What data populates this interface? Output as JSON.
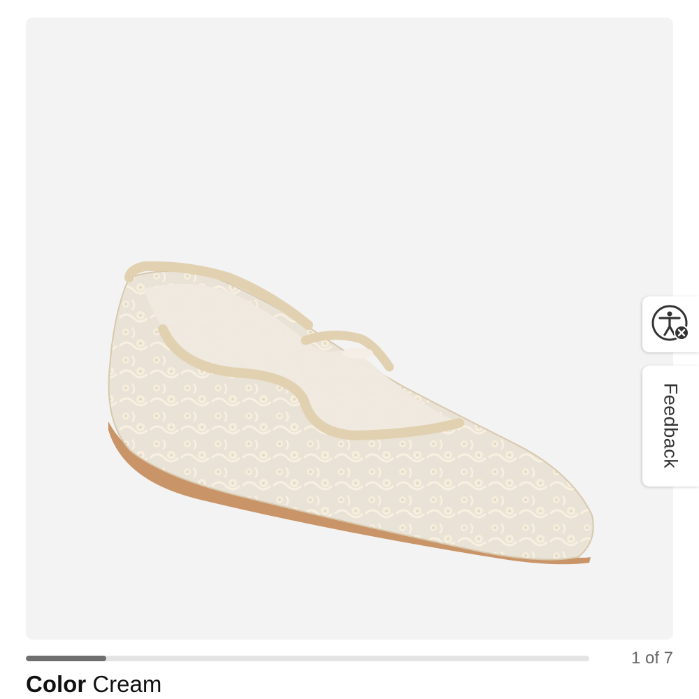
{
  "gallery": {
    "image_alt": "Cream lace pointed-toe ballet flat",
    "current": 1,
    "total": 7,
    "counter_text": "1 of 7",
    "progress_fraction": 0.143
  },
  "side_tabs": {
    "accessibility_icon": "accessibility-icon",
    "feedback_label": "Feedback"
  },
  "product": {
    "color_label": "Color",
    "color_value": "Cream"
  },
  "colors": {
    "image_bg": "#f3f3f3",
    "progress_track": "#e4e4e4",
    "progress_fill": "#6f6f6f"
  }
}
